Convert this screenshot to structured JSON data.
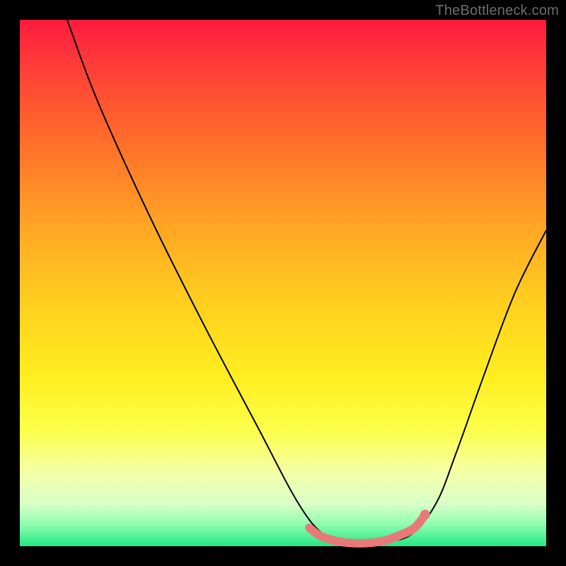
{
  "watermark": "TheBottleneck.com",
  "chart_data": {
    "type": "line",
    "title": "",
    "xlabel": "",
    "ylabel": "",
    "xlim": [
      0,
      100
    ],
    "ylim": [
      0,
      100
    ],
    "grid": false,
    "legend": false,
    "background": "rainbow-vertical-gradient",
    "series": [
      {
        "name": "bottleneck-curve",
        "color": "#000000",
        "x": [
          9,
          15,
          25,
          35,
          45,
          53,
          58,
          62,
          68,
          74,
          79,
          83,
          88,
          94,
          100
        ],
        "y": [
          100,
          84,
          62,
          42,
          23,
          8,
          2,
          1,
          1,
          2,
          8,
          18,
          32,
          48,
          60
        ]
      },
      {
        "name": "optimal-flat-segment",
        "color": "#e77a79",
        "x": [
          55,
          57,
          60,
          63,
          66,
          69,
          72,
          75,
          77
        ],
        "y": [
          3.5,
          2,
          1,
          0.6,
          0.6,
          1,
          2,
          3.5,
          6
        ]
      }
    ],
    "markers": [
      {
        "name": "flat-end-dot",
        "x": 77,
        "y": 6,
        "color": "#e77a79"
      }
    ]
  }
}
